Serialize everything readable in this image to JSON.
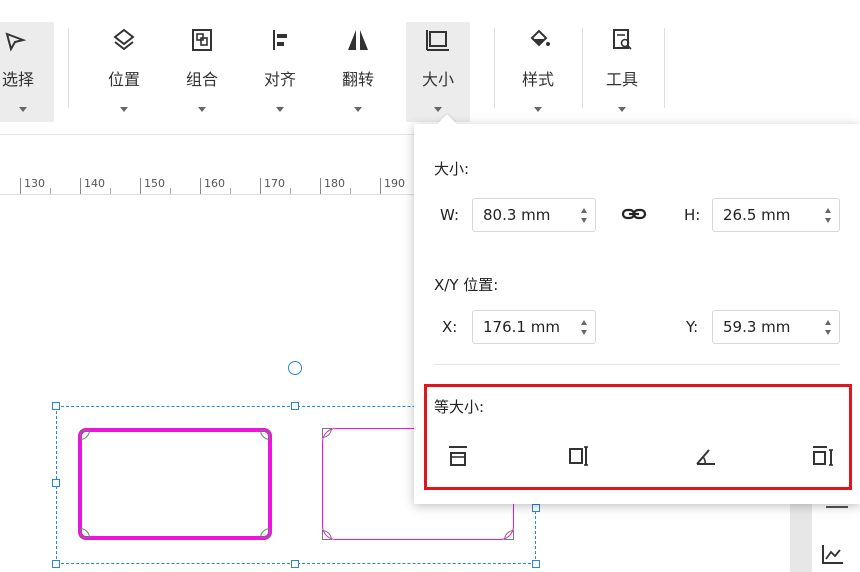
{
  "toolbar": {
    "items": [
      {
        "label": "选择",
        "icon": "select-pointer-icon"
      },
      {
        "label": "位置",
        "icon": "position-layers-icon"
      },
      {
        "label": "组合",
        "icon": "group-icon"
      },
      {
        "label": "对齐",
        "icon": "align-icon"
      },
      {
        "label": "翻转",
        "icon": "flip-icon"
      },
      {
        "label": "大小",
        "icon": "size-icon"
      },
      {
        "label": "样式",
        "icon": "style-fill-icon"
      },
      {
        "label": "工具",
        "icon": "tools-icon"
      }
    ]
  },
  "ruler": {
    "ticks": [
      "130",
      "140",
      "150",
      "160",
      "170",
      "180",
      "190"
    ]
  },
  "size_panel": {
    "size_title": "大小:",
    "w_label": "W:",
    "w_value": "80.3 mm",
    "h_label": "H:",
    "h_value": "26.5 mm",
    "link_icon": "link-icon",
    "pos_title": "X/Y 位置:",
    "x_label": "X:",
    "x_value": "176.1 mm",
    "y_label": "Y:",
    "y_value": "59.3 mm",
    "equal_title": "等大小:",
    "equal_buttons": [
      "same-width-icon",
      "same-height-icon",
      "same-angle-icon",
      "same-size-icon"
    ]
  },
  "colors": {
    "selection": "#2a86d8",
    "shape_stroke": "#ee14e0",
    "highlight": "#e0161e"
  }
}
